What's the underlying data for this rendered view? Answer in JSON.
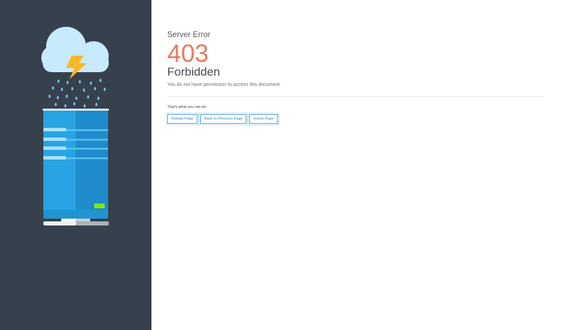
{
  "error": {
    "subtitle": "Server Error",
    "code": "403",
    "title": "Forbidden",
    "message": "You do not have permission to access this document."
  },
  "actions": {
    "heading": "That's what you can do",
    "buttons": [
      {
        "label": "Reload Page"
      },
      {
        "label": "Back to Previous Page"
      },
      {
        "label": "Home Page"
      }
    ]
  },
  "colors": {
    "sidebar": "#36414d",
    "code": "#e87a5d",
    "button_border": "#4aa3d8",
    "cloud": "#c8eafd",
    "server": "#2a9fdf",
    "lightning": "#f7b825",
    "led": "#7ee81a"
  },
  "icons": [
    "cloud-icon",
    "lightning-icon",
    "rain-icon",
    "server-icon"
  ]
}
